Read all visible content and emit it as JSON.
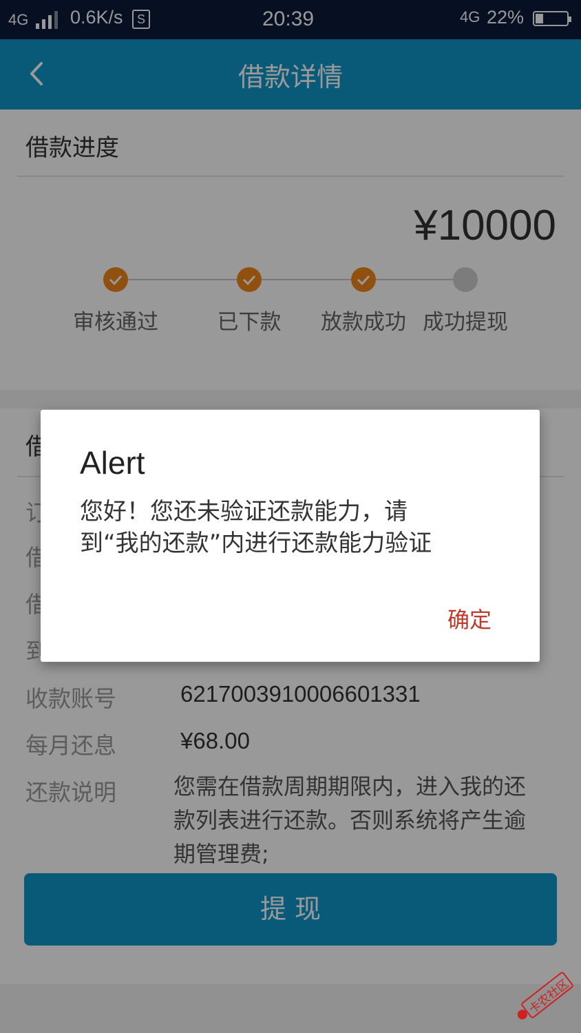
{
  "status_bar": {
    "network": "4G",
    "speed": "0.6K/s",
    "time": "20:39",
    "network2": "4G",
    "battery": "22%",
    "battery_level": 0.22
  },
  "nav": {
    "title": "借款详情"
  },
  "progress": {
    "title": "借款进度",
    "amount": "¥10000",
    "steps": [
      {
        "label": "审核通过",
        "done": true
      },
      {
        "label": "已下款",
        "done": true
      },
      {
        "label": "放款成功",
        "done": true
      },
      {
        "label": "成功提现",
        "done": false
      }
    ]
  },
  "details": {
    "title_partial": "借",
    "partial_labels": [
      "订",
      "借",
      "借",
      "到"
    ],
    "rows": [
      {
        "label": "收款账号",
        "value": "6217003910006601331"
      },
      {
        "label": "每月还息",
        "value": "¥68.00"
      }
    ],
    "repay_label": "还款说明",
    "repay_text": "您需在借款周期期限内，进入我的还款列表进行还款。否则系统将产生逾期管理费;",
    "button": "提 现"
  },
  "dialog": {
    "title": "Alert",
    "message_line1": "您好！您还未验证还款能力，请",
    "message_line2": "到“我的还款”内进行还款能力验证",
    "ok": "确定"
  },
  "watermark": "卡农社区",
  "colors": {
    "primary": "#0f96c9",
    "accent": "#f0881c",
    "ok": "#c0392b"
  }
}
